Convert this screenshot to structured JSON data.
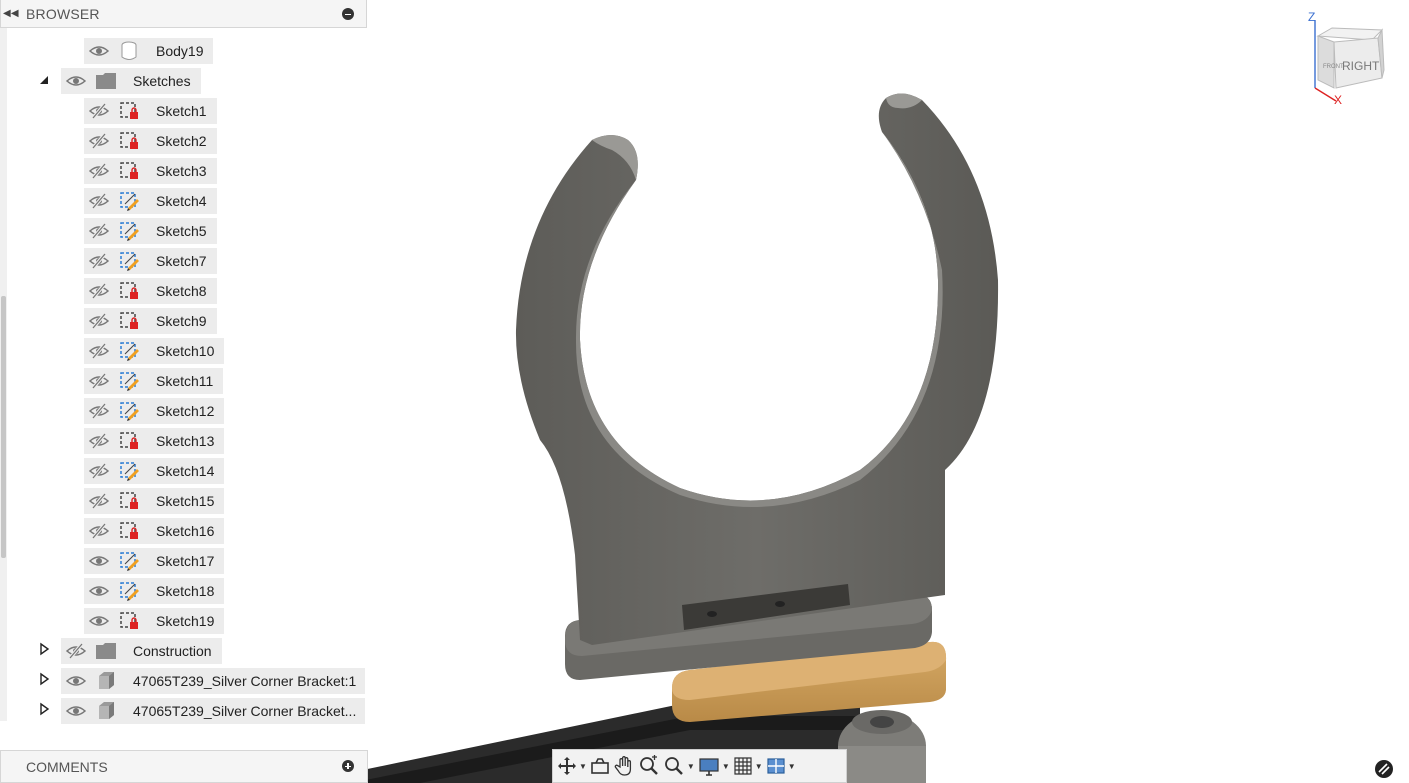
{
  "browser": {
    "title": "BROWSER",
    "items": [
      {
        "label": "Body19",
        "level": 2,
        "visible": true,
        "type": "body"
      },
      {
        "label": "Sketches",
        "level": 1,
        "visible": true,
        "type": "folder",
        "expanded": true
      },
      {
        "label": "Sketch1",
        "level": 2,
        "visible": false,
        "type": "sketch-locked"
      },
      {
        "label": "Sketch2",
        "level": 2,
        "visible": false,
        "type": "sketch-locked"
      },
      {
        "label": "Sketch3",
        "level": 2,
        "visible": false,
        "type": "sketch-locked"
      },
      {
        "label": "Sketch4",
        "level": 2,
        "visible": false,
        "type": "sketch-edit"
      },
      {
        "label": "Sketch5",
        "level": 2,
        "visible": false,
        "type": "sketch-edit"
      },
      {
        "label": "Sketch7",
        "level": 2,
        "visible": false,
        "type": "sketch-edit"
      },
      {
        "label": "Sketch8",
        "level": 2,
        "visible": false,
        "type": "sketch-locked"
      },
      {
        "label": "Sketch9",
        "level": 2,
        "visible": false,
        "type": "sketch-locked"
      },
      {
        "label": "Sketch10",
        "level": 2,
        "visible": false,
        "type": "sketch-edit"
      },
      {
        "label": "Sketch11",
        "level": 2,
        "visible": false,
        "type": "sketch-edit"
      },
      {
        "label": "Sketch12",
        "level": 2,
        "visible": false,
        "type": "sketch-edit"
      },
      {
        "label": "Sketch13",
        "level": 2,
        "visible": false,
        "type": "sketch-locked"
      },
      {
        "label": "Sketch14",
        "level": 2,
        "visible": false,
        "type": "sketch-edit"
      },
      {
        "label": "Sketch15",
        "level": 2,
        "visible": false,
        "type": "sketch-locked"
      },
      {
        "label": "Sketch16",
        "level": 2,
        "visible": false,
        "type": "sketch-locked"
      },
      {
        "label": "Sketch17",
        "level": 2,
        "visible": true,
        "type": "sketch-edit"
      },
      {
        "label": "Sketch18",
        "level": 2,
        "visible": true,
        "type": "sketch-edit"
      },
      {
        "label": "Sketch19",
        "level": 2,
        "visible": true,
        "type": "sketch-locked"
      },
      {
        "label": "Construction",
        "level": 1,
        "visible": false,
        "type": "folder",
        "expanded": false
      },
      {
        "label": "47065T239_Silver Corner Bracket:1",
        "level": 1,
        "visible": true,
        "type": "component",
        "expanded": false
      },
      {
        "label": "47065T239_Silver Corner Bracket...",
        "level": 1,
        "visible": true,
        "type": "component",
        "expanded": false
      }
    ]
  },
  "comments": {
    "title": "COMMENTS"
  },
  "viewcube": {
    "face_label": "RIGHT",
    "side_label": "FRONT",
    "axis_z": "Z",
    "axis_x": "X"
  },
  "toolbar": {
    "buttons": [
      "orbit-icon",
      "look-at-icon",
      "pan-icon",
      "zoom-icon",
      "fit-icon",
      "display-settings-icon",
      "grid-icon",
      "viewports-icon"
    ]
  },
  "colors": {
    "panel_bg": "#f5f5f5",
    "row_bg": "#ececec",
    "part_gray": "#6b6a66",
    "wood": "#c99955",
    "accent_red": "#d22",
    "accent_blue": "#2b7cd3"
  }
}
